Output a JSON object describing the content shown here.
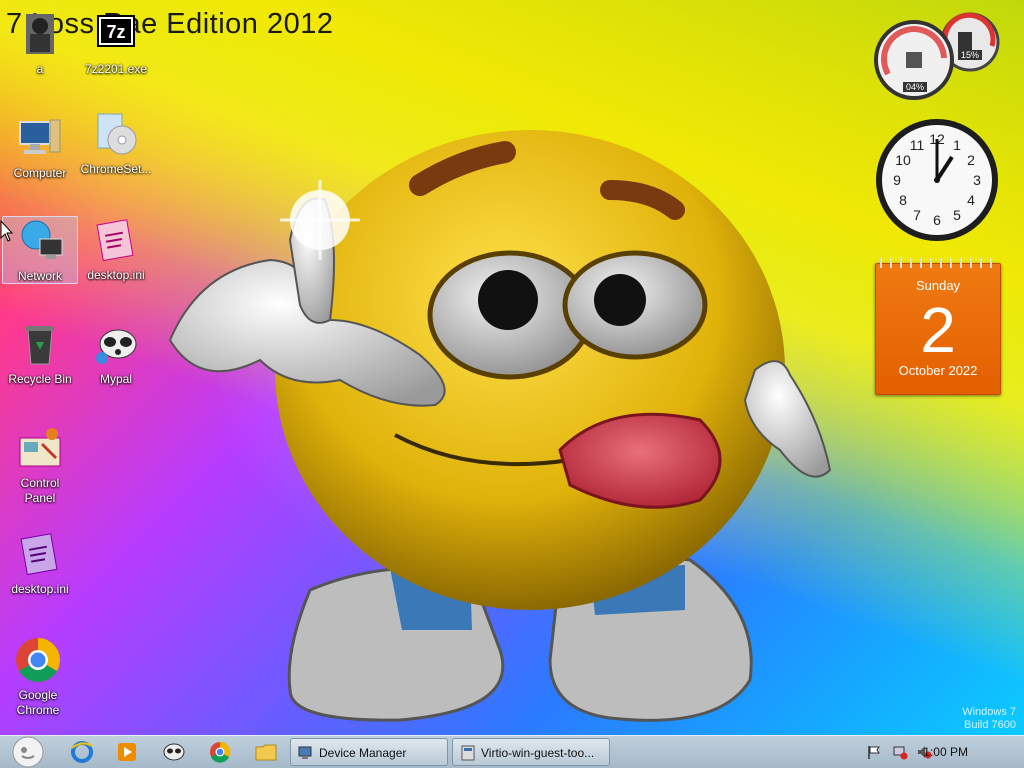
{
  "wallpaper": {
    "title": "7 Loss Rae Edition 2012",
    "watermark_line1": "Windows 7",
    "watermark_line2": "Build 7600"
  },
  "desktop_icons": [
    {
      "label": "a"
    },
    {
      "label": "7z2201.exe"
    },
    {
      "label": "Computer"
    },
    {
      "label": "ChromeSet..."
    },
    {
      "label": "Network"
    },
    {
      "label": "desktop.ini"
    },
    {
      "label": "Recycle Bin"
    },
    {
      "label": "Mypal"
    },
    {
      "label": "Control Panel"
    },
    {
      "label": "desktop.ini"
    },
    {
      "label": "Google Chrome"
    }
  ],
  "gadgets": {
    "meter": {
      "cpu": "04%",
      "memory": "15%"
    },
    "clock": {
      "numbers": [
        "12",
        "1",
        "2",
        "3",
        "4",
        "5",
        "6",
        "7",
        "8",
        "9",
        "10",
        "11"
      ]
    },
    "calendar": {
      "day_name": "Sunday",
      "day_number": "2",
      "month_year": "October 2022"
    }
  },
  "taskbar": {
    "buttons": [
      {
        "label": "Device Manager"
      },
      {
        "label": "Virtio-win-guest-too..."
      }
    ],
    "clock": "1:00 PM"
  },
  "colors": {
    "accent": "#e35f00",
    "taskbar": "#b0c2d0"
  }
}
